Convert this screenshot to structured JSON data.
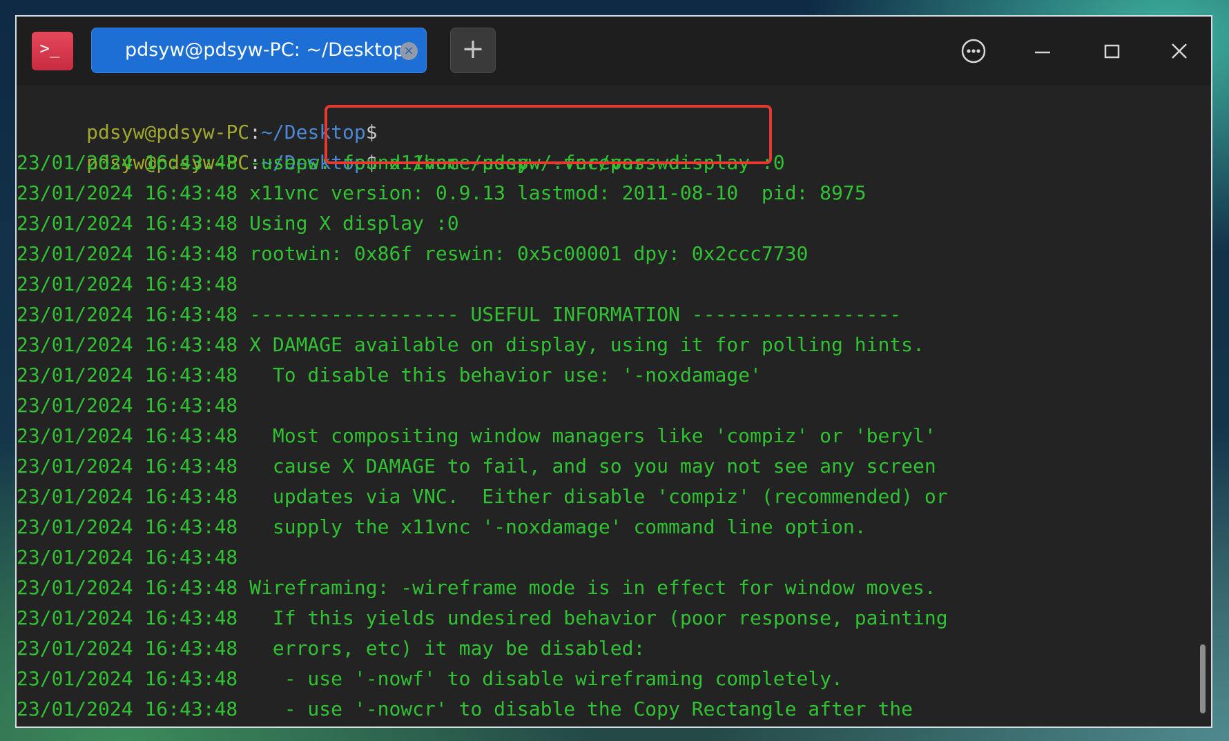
{
  "window": {
    "tab_title": "pdsyw@pdsyw-PC: ~/Desktop",
    "tab_close_glyph": "×",
    "new_tab_glyph": "+",
    "app_icon_glyph": ">_"
  },
  "colors": {
    "terminal_background": "#232323",
    "output_text": "#30c232",
    "prompt_user": "#a1a82d",
    "prompt_path": "#4c88d6",
    "tab_active": "#1d6fd6",
    "highlight_box": "#e53a30"
  },
  "icons": {
    "app": "terminal-icon",
    "menu": "more-options-icon",
    "minimize": "minimize-icon",
    "maximize": "maximize-icon",
    "close": "close-icon"
  },
  "terminal": {
    "prompt": {
      "user_host": "pdsyw@pdsyw-PC",
      "colon": ":",
      "path": "~/Desktop",
      "dollar": "$"
    },
    "prompt_line_1": {
      "command": ""
    },
    "prompt_line_2": {
      "command": " x11vnc -usepw -forever -display :0"
    },
    "output_lines": [
      "23/01/2024 16:43:48 -usepw: found /home/pdsyw/.vnc/passwd",
      "23/01/2024 16:43:48 x11vnc version: 0.9.13 lastmod: 2011-08-10  pid: 8975",
      "23/01/2024 16:43:48 Using X display :0",
      "23/01/2024 16:43:48 rootwin: 0x86f reswin: 0x5c00001 dpy: 0x2ccc7730",
      "23/01/2024 16:43:48",
      "23/01/2024 16:43:48 ------------------ USEFUL INFORMATION ------------------",
      "23/01/2024 16:43:48 X DAMAGE available on display, using it for polling hints.",
      "23/01/2024 16:43:48   To disable this behavior use: '-noxdamage'",
      "23/01/2024 16:43:48",
      "23/01/2024 16:43:48   Most compositing window managers like 'compiz' or 'beryl'",
      "23/01/2024 16:43:48   cause X DAMAGE to fail, and so you may not see any screen",
      "23/01/2024 16:43:48   updates via VNC.  Either disable 'compiz' (recommended) or",
      "23/01/2024 16:43:48   supply the x11vnc '-noxdamage' command line option.",
      "23/01/2024 16:43:48",
      "23/01/2024 16:43:48 Wireframing: -wireframe mode is in effect for window moves.",
      "23/01/2024 16:43:48   If this yields undesired behavior (poor response, painting",
      "23/01/2024 16:43:48   errors, etc) it may be disabled:",
      "23/01/2024 16:43:48    - use '-nowf' to disable wireframing completely.",
      "23/01/2024 16:43:48    - use '-nowcr' to disable the Copy Rectangle after the"
    ]
  }
}
